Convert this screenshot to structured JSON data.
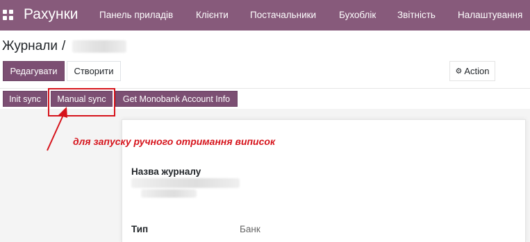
{
  "navbar": {
    "app_name": "Рахунки",
    "menu": [
      {
        "label": "Панель приладів"
      },
      {
        "label": "Клієнти"
      },
      {
        "label": "Постачальники"
      },
      {
        "label": "Бухоблік"
      },
      {
        "label": "Звітність"
      },
      {
        "label": "Налаштування"
      }
    ]
  },
  "breadcrumb": {
    "parent": "Журнали",
    "separator": "/"
  },
  "control_panel": {
    "edit_label": "Редагувати",
    "create_label": "Створити",
    "action_label": "Action"
  },
  "form_header": {
    "buttons": [
      {
        "label": "Init sync"
      },
      {
        "label": "Manual sync"
      },
      {
        "label": "Get Monobank Account Info"
      }
    ]
  },
  "annotation": {
    "text": "для запуску ручного отримання виписок",
    "color": "#d6131b"
  },
  "form": {
    "journal_name_label": "Назва журналу",
    "type_label": "Тип",
    "type_value": "Банк"
  },
  "colors": {
    "navbar": "#875a7b",
    "primary_button": "#7c4f73",
    "highlight": "#d6131b"
  },
  "icons": {
    "apps": "apps-grid-icon",
    "action": "gear-icon"
  }
}
